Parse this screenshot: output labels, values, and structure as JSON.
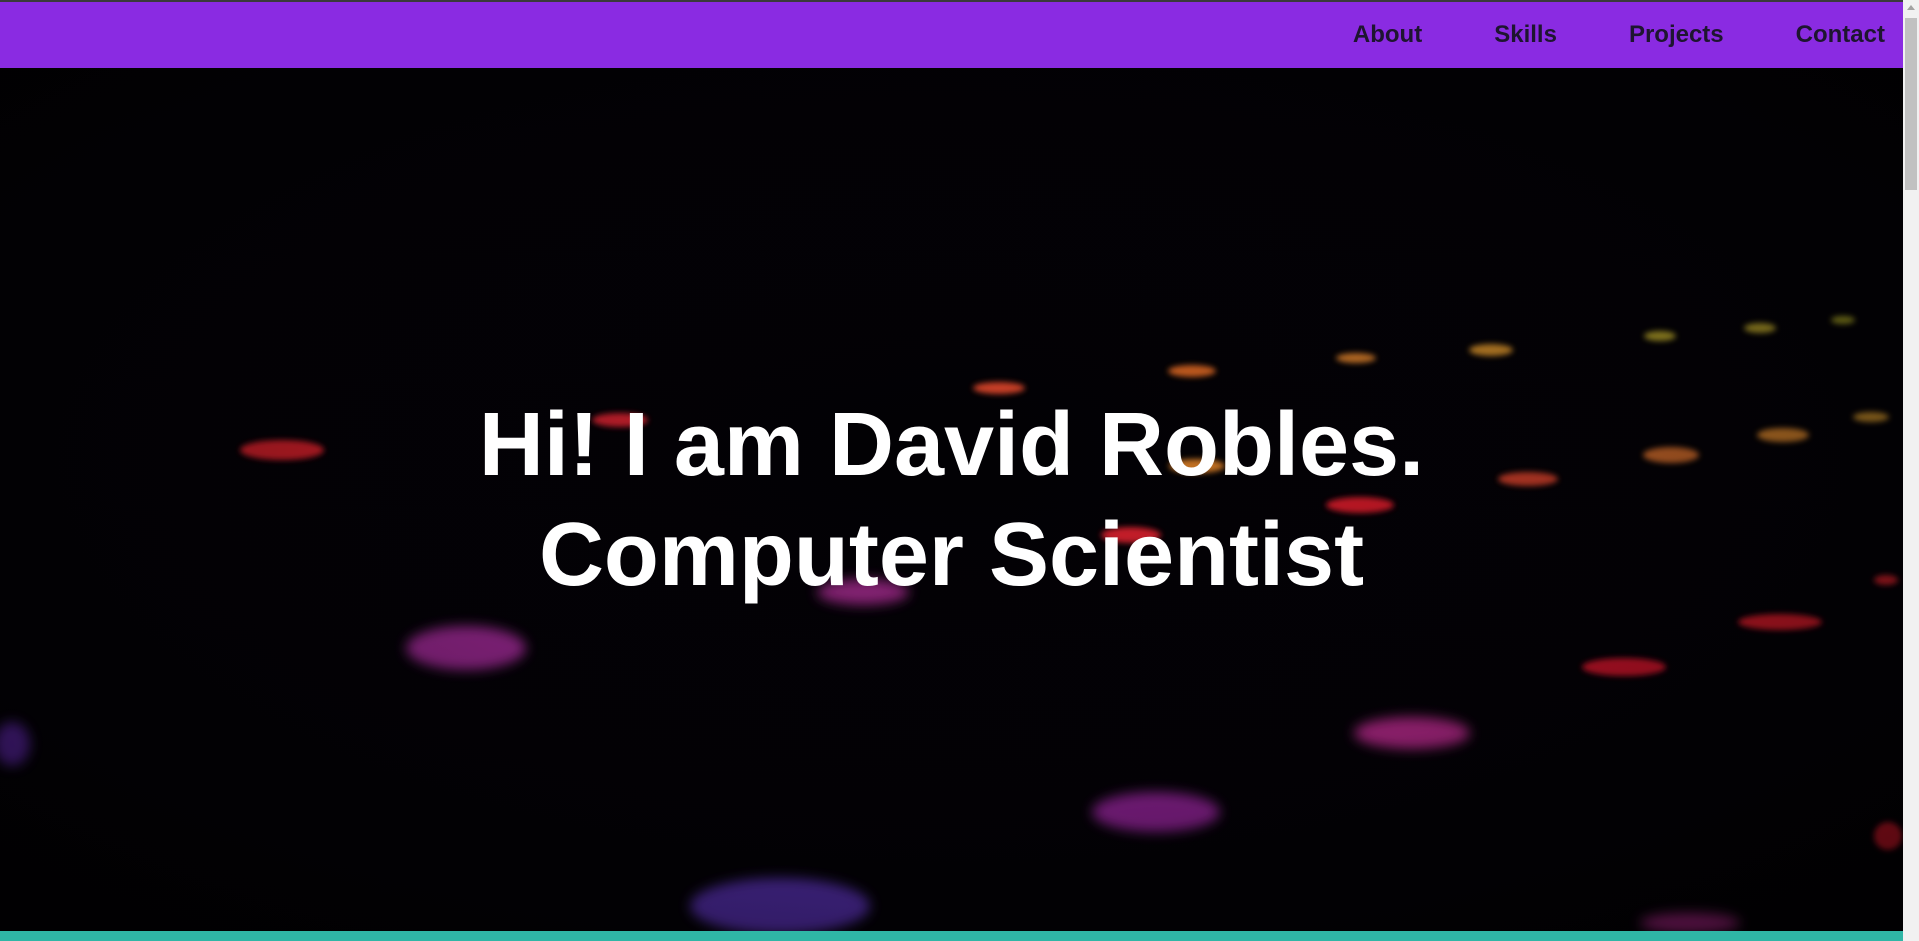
{
  "nav": {
    "items": [
      {
        "label": "About"
      },
      {
        "label": "Skills"
      },
      {
        "label": "Projects"
      },
      {
        "label": "Contact"
      }
    ]
  },
  "hero": {
    "line1": "Hi! I am David Robles.",
    "line2": "Computer Scientist"
  },
  "colors": {
    "navbar": "#8a2be2",
    "hero_background": "#000000",
    "hero_text": "#ffffff",
    "bottom_bar": "#2fb6a6"
  }
}
